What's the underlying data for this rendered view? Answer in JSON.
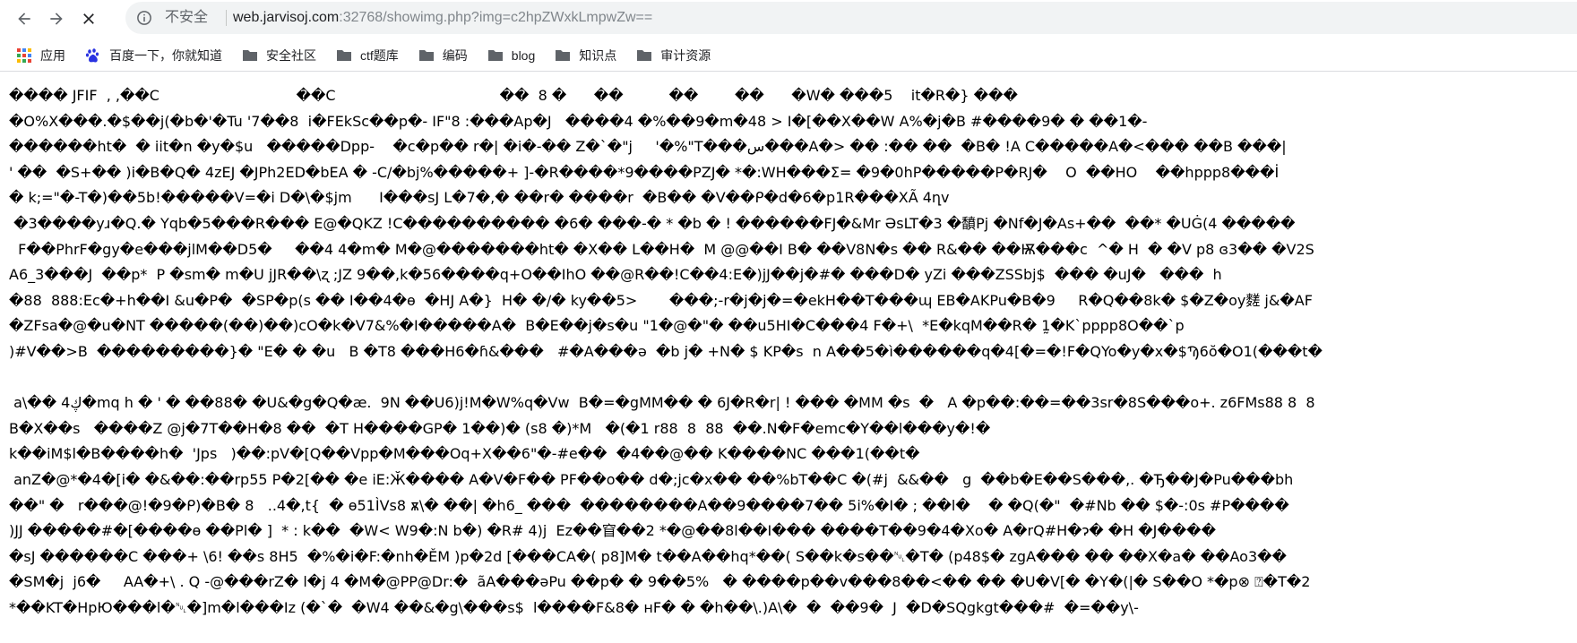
{
  "toolbar": {
    "back_icon": "arrow-left-icon",
    "forward_icon": "arrow-right-icon",
    "stop_icon": "close-icon",
    "security_icon": "info-circle-icon",
    "security_label": "不安全",
    "url_host": "web.jarvisoj.com",
    "url_rest": ":32768/showimg.php?img=c2hpZWxkLmpwZw=="
  },
  "bookmarks": [
    {
      "label": "应用",
      "icon": "apps-grid-icon"
    },
    {
      "label": "百度一下，你就知道",
      "icon": "baidu-paw-icon"
    },
    {
      "label": "安全社区",
      "icon": "folder-icon"
    },
    {
      "label": "ctf题库",
      "icon": "folder-icon"
    },
    {
      "label": "编码",
      "icon": "folder-icon"
    },
    {
      "label": "blog",
      "icon": "folder-icon"
    },
    {
      "label": "知识点",
      "icon": "folder-icon"
    },
    {
      "label": "审计资源",
      "icon": "folder-icon"
    }
  ],
  "colors": {
    "apps_red": "#ea4335",
    "apps_blue": "#4285f4",
    "apps_yellow": "#fbbc05",
    "apps_green": "#34a853",
    "baidu_blue": "#2932e1",
    "folder": "#5f6368"
  },
  "page": {
    "lines": [
      "���� JFIF  , ,��C                              ��C                                    ��  8 �      ��          ��        ��      �W� ���5    it�R�} ���",
      "�O%X���.�$��j(�b�'�Tu '7��8  i�FEkSc��p�- IF\"8 :���Ap�J   ����4 �%��9�m�48 > I�[��X��W A%�j�B #����9� � ��1�-",
      "������ht�  � iit�n �y�$u   �����Dpp-    �c�p�� r�| �i�-�� Z�`�\"j     '�%\"T���س���A�> �� :�� ��  �B� !A C�����A�<��� ��B ���|",
      "' ��  �S+�� )i�B�Q� 4zEJ �JPh2ED�bEA � -C/�bj%�����+ ]-�R����*9����PZJ� *�:WH���Σ= �9�0hP�����P�RJ�    O  ��HO    ��hppp8���İ",
      "� k;=\"�-T�)��5b!�����V=�i D�\\�$jm      I���sJ L�7�,� ��r� ����r  �B�� �V��ᑭ�d�6�p1R���XÃ 4ղv",
      " �3����yɹ�Q.� Yqb�5���R��� E@�QKZ !C���������� �6� ���-� * �b � ! ������FJ�&Mr ƏsLT�3 �馩Pj �Nf�J�As+��  ��* �UĠ(4 �����",
      "  F��PhrF�gy�e���jlM��D5�     ��4 4�m� M�@�������ht� �X�� L��H�  M @@��I B� ��V8N�s �� R&�� ��Ѭ���c  ^� H  � �V p8 ɞ3�� �V2S",
      "A6_3���J  ��p*  P �sm� m�U jJR��\\ʐ ;JZ 9��,k�56����q+O��IhO ��@R��!C��4:E�)jJ��j�#� ���D� yZi ���ZSSbj$  ��� �uJ�   ���  h",
      "�88  888:Ec�+h��I &u�P�  �SP�p(s �� I��4�ө  �HJ A�}  H� �/� ky��5>       ���;-r�j�j�=�ekH��T���ɰ EB�AKPu�B�9     R�Q��8k� $�Z�oy䴾 j&�AF",
      "�ZFsa�@�u�NT �����(��)��)cO�k�V7&%�I�����A�  B�E��j�s�u \"1�@�\"� ��u5HI�C���4 F�+\\  *E�kqM��R� 1̰�K`pppp8O��`p",
      ")#V��>B  ���������}� \"E� � �u   B �T8 ���H6�ɦ&���   #�A���ə  �b j� +N� $ KP�s  n A��5�ì������q�4[�=�!F�QYo�y�x�$Ϡ6ŏ�O1(���t�",
      "",
      " a\\�� 4ڮ�mq h � ' � ��88� �U&�g�Q�æ.  9N ��U6)j!M�W%q�Vw  B�=�gMM�� � 6J�R�r| ! ��� �MM �s  �   A �p��:��=��3sr�8S���o+. z6FMs88 8  8",
      "B�X��s   ����Z @j�7T��H�8 ��  �T H����GP� 1��)� (s8 �)*M   �(�1 r88  8  88  ��.N�F�emc�Y��l���y�!�",
      "k��iM$l�B����h�  'Jps   )��:pV�[Q��Vpp�M���Oq+X��6\"�-#e��  �4��@�� K����NC ���1(��t�",
      " anZ�@*�4�[i� �&��:��rp55 P�2[�� �e iE:Ӂ���� A�V�F�� PF��o�� d�;jc�x�� ��%bT��C �(#j  &&��   g  ��b�E��S���,. �Ђ��J�Pu���bh",
      "��\" �   r���@!�9�ᑭ)�B� 8   ..4�,t{  � ɵ51ÌVs8 ѫ\\� ��| �h6_ ���  ��������A��9����7�� 5i%�I� ; ��l�    � �Q(�\"  �#Nb �� $�-:0s #P����",
      ")JJ �����#�[����ɵ ��Pl� ]  * : k��  �W< W9�:N b�) �R# 4)j  Ez��窅��2 *�@��8l��I��� ����T��9�4�Xo� A�rQ#H�ɂ� �H �J����",
      "�sJ ������C ���+ \\6! ��s 8H5  �%�i�F:�nh�ĚM )p�2d [���CA�( p8]M� t��A��hq*��( S��k�s��␀�T� (p48$� zgA��� �� ��X�a� ��Ao3��",
      "�SM�j  j6�     AA�+\\ . Q -@���rZ� l�j 4 �M�@PP@Dr:�  ãA���əPu ��p� � 9��5%   � ����p��v���8��<�� �� �U�V[� �Y�(|� S��O *�p⊗ ⍰�T�2",
      "*��KT�HpЮ���l�␀�]m�l���Iz (�`�  �W4 ��&�g\\���s$  l����F&8� ʜF� � �h��\\.)A\\�  �  ��9�  J  �D�SQgkgt���#  �=��y\\-"
    ]
  }
}
